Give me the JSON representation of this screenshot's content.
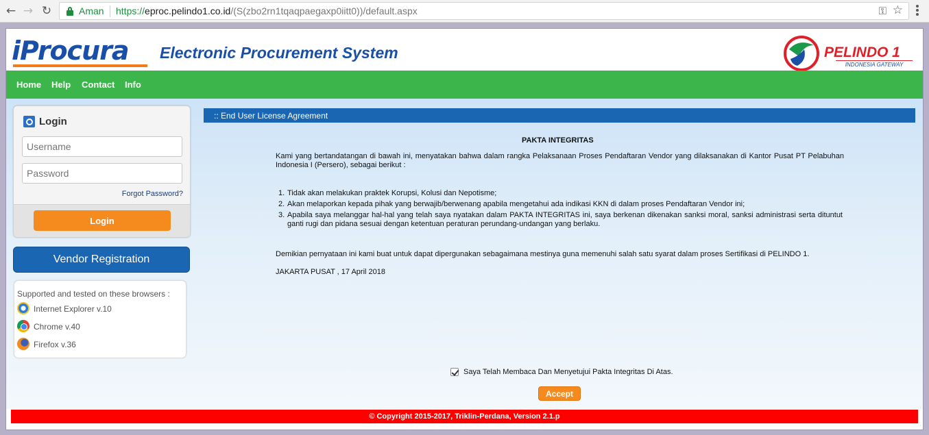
{
  "browser": {
    "secure_label": "Aman",
    "url_protocol": "https://",
    "url_host": "eproc.pelindo1.co.id",
    "url_path": "/(S(zbo2rn1tqaqpaegaxp0iitt0))/default.aspx"
  },
  "header": {
    "logo_text": "iProcura",
    "title": "Electronic Procurement System",
    "partner_name": "PELINDO 1",
    "partner_tagline": "INDONESIA GATEWAY",
    "colors": {
      "brand_blue": "#1a4fa8",
      "brand_orange": "#f07c1b",
      "partner_red": "#e02028"
    }
  },
  "nav": {
    "items": [
      {
        "label": "Home"
      },
      {
        "label": "Help"
      },
      {
        "label": "Contact"
      },
      {
        "label": "Info"
      }
    ],
    "color": "#3cb64a"
  },
  "login": {
    "title": "Login",
    "username_placeholder": "Username",
    "password_placeholder": "Password",
    "forgot_label": "Forgot Password?",
    "submit_label": "Login"
  },
  "vendor_registration_label": "Vendor Registration",
  "browsers": {
    "title": "Supported and tested on these browsers :",
    "items": [
      {
        "name": "Internet Explorer v.10",
        "icon": "internet-explorer-icon"
      },
      {
        "name": "Chrome v.40",
        "icon": "chrome-icon"
      },
      {
        "name": "Firefox v.36",
        "icon": "firefox-icon"
      }
    ]
  },
  "eula": {
    "header": ":: End User License Agreement",
    "title": "PAKTA INTEGRITAS",
    "intro": "Kami yang bertandatangan di bawah ini, menyatakan bahwa dalam rangka Pelaksanaan Proses Pendaftaran Vendor yang dilaksanakan di Kantor Pusat PT Pelabuhan Indonesia I (Persero), sebagai berikut :",
    "points": [
      {
        "num": "1.",
        "text": "Tidak akan melakukan praktek Korupsi, Kolusi dan Nepotisme;"
      },
      {
        "num": "2.",
        "text": "Akan melaporkan kepada pihak yang berwajib/berwenang apabila mengetahui ada indikasi KKN di dalam proses Pendaftaran Vendor ini;"
      },
      {
        "num": "3.",
        "text": "Apabila saya melanggar hal-hal yang telah saya nyatakan dalam PAKTA INTEGRITAS ini, saya berkenan dikenakan sanksi moral, sanksi administrasi serta dituntut ganti rugi dan pidana sesuai dengan ketentuan peraturan perundang-undangan yang berlaku."
      }
    ],
    "closing": "Demikian pernyataan ini kami buat untuk dapat dipergunakan sebagaimana mestinya guna memenuhi salah satu syarat dalam proses Sertifikasi di PELINDO 1.",
    "place_date": "JAKARTA PUSAT , 17 April 2018",
    "agree_label": "Saya Telah Membaca Dan Menyetujui Pakta Integritas Di Atas.",
    "agree_checked": true,
    "accept_label": "Accept"
  },
  "footer": {
    "text": "© Copyright 2015-2017, Triklin-Perdana, Version 2.1.p",
    "color": "#ff0000"
  }
}
